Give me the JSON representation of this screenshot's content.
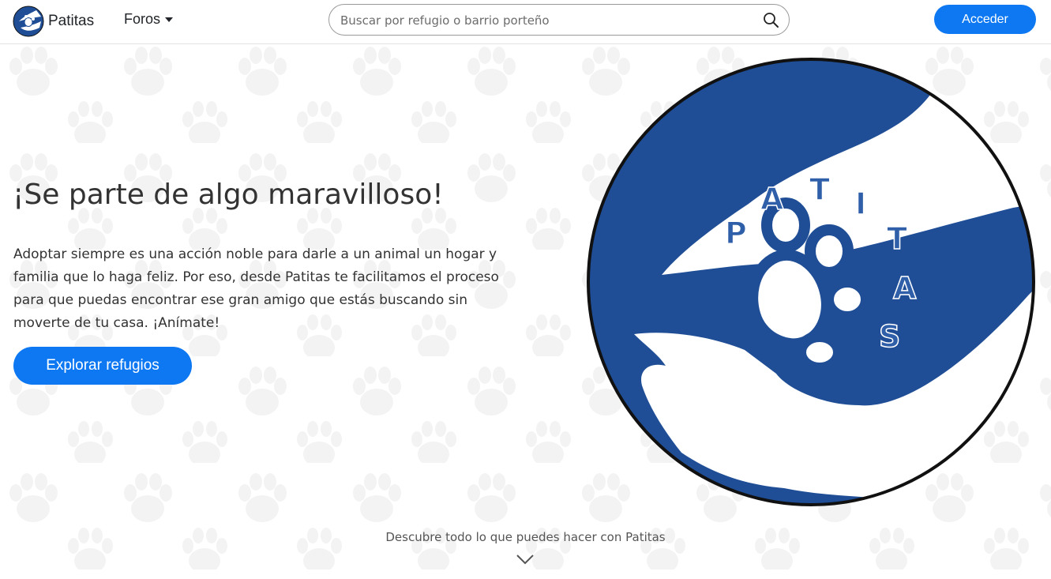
{
  "brand": {
    "name": "Patitas"
  },
  "nav": {
    "foros_label": "Foros"
  },
  "search": {
    "placeholder": "Buscar por refugio o barrio porteño",
    "value": ""
  },
  "auth": {
    "login_label": "Acceder"
  },
  "hero": {
    "title": "¡Se parte de algo maravilloso!",
    "text": "Adoptar siempre es una acción noble para darle a un animal un hogar y familia que lo haga feliz. Por eso, desde Patitas te facilitamos el proceso para que puedas encontrar ese gran amigo que estás buscando sin moverte de tu casa. ¡Anímate!",
    "cta_label": "Explorar refugios",
    "logo_letters": [
      "P",
      "A",
      "T",
      "I",
      "T",
      "A",
      "S"
    ]
  },
  "footer_hint": {
    "text": "Descubre todo lo que puedes hacer con Patitas"
  },
  "colors": {
    "accent": "#0d78f2",
    "logo_blue": "#1f4e96"
  }
}
